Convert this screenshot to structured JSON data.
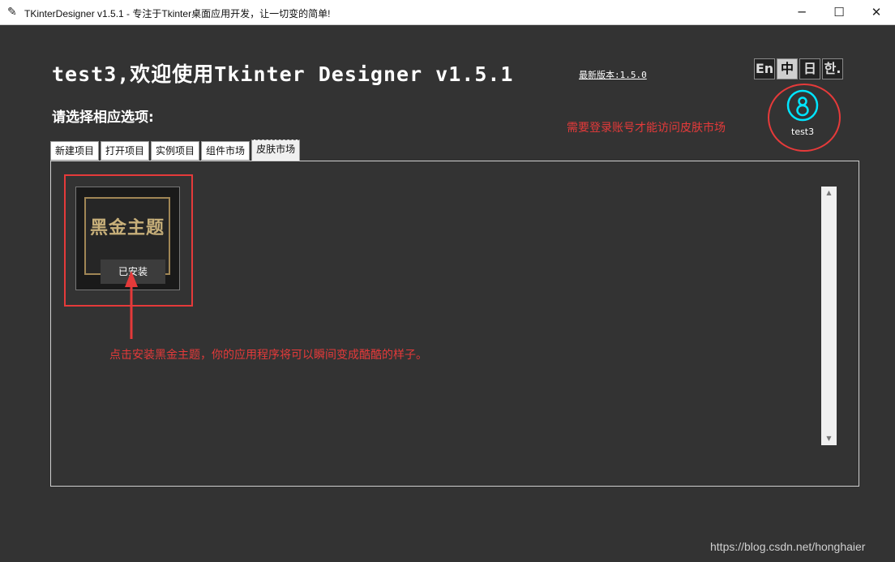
{
  "window": {
    "title": "TKinterDesigner v1.5.1 - 专注于Tkinter桌面应用开发，让一切变的简单!",
    "min_glyph": "─",
    "max_glyph": "☐",
    "close_glyph": "✕"
  },
  "header": {
    "welcome": "test3,欢迎使用Tkinter Designer v1.5.1",
    "latest_version": "最新版本:1.5.0",
    "subtitle": "请选择相应选项:"
  },
  "languages": [
    {
      "label": "En",
      "active": false
    },
    {
      "label": "中",
      "active": true
    },
    {
      "label": "日",
      "active": false
    },
    {
      "label": "한.",
      "active": false
    }
  ],
  "user": {
    "name": "test3",
    "icon": "user-icon"
  },
  "annotations": {
    "login_note": "需要登录账号才能访问皮肤市场",
    "install_note": "点击安装黑金主题，你的应用程序将可以瞬间变成酷酷的样子。"
  },
  "tabs": [
    {
      "label": "新建项目",
      "active": false
    },
    {
      "label": "打开项目",
      "active": false
    },
    {
      "label": "实例项目",
      "active": false
    },
    {
      "label": "组件市场",
      "active": false
    },
    {
      "label": "皮肤市场",
      "active": true
    }
  ],
  "skins": [
    {
      "title": "黑金主题",
      "button": "已安装"
    }
  ],
  "watermark": "https://blog.csdn.net/honghaier",
  "colors": {
    "accent_red": "#e53a3a",
    "avatar_cyan": "#00e5ff",
    "gold": "#c8b07a"
  }
}
